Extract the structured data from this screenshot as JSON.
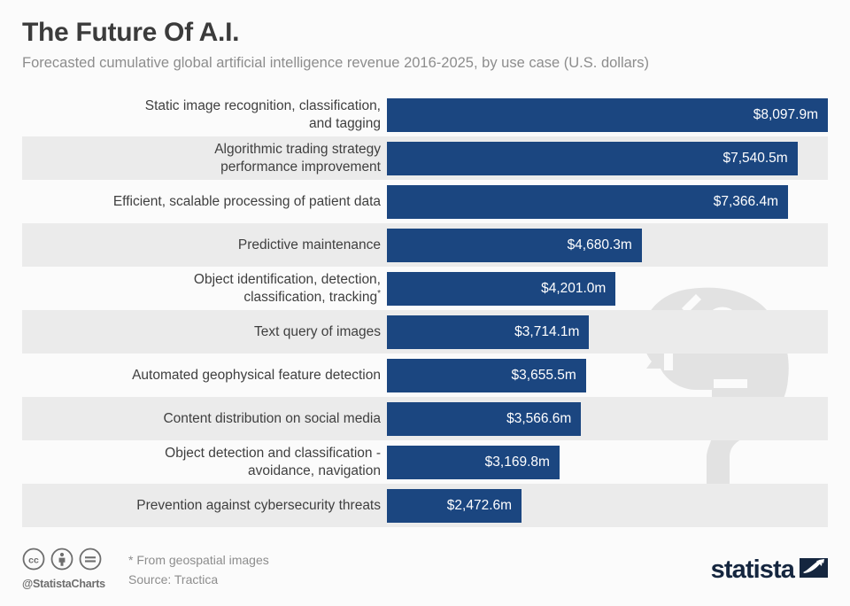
{
  "header": {
    "title": "The Future Of A.I.",
    "subtitle": "Forecasted cumulative global artificial intelligence revenue 2016-2025, by use case (U.S. dollars)"
  },
  "footer": {
    "cc_label": "cc",
    "handle": "@StatistaCharts",
    "footnote": "* From geospatial images",
    "source": "Source: Tractica",
    "logo_text": "statista",
    "icons": {
      "cc": "creative-commons-icon",
      "by": "attribution-person-icon",
      "nd": "no-derivatives-equals-icon",
      "logo_mark": "statista-swoosh-icon"
    }
  },
  "colors": {
    "bar": "#1b4680",
    "band": "#ebebeb",
    "background": "#fbfbfb",
    "title": "#3b3b3b",
    "subtitle": "#8d8d8d",
    "label": "#3f3f3f",
    "logo": "#15263f"
  },
  "chart_data": {
    "type": "bar",
    "orientation": "horizontal",
    "title": "The Future Of A.I.",
    "subtitle": "Forecasted cumulative global artificial intelligence revenue 2016-2025, by use case (U.S. dollars)",
    "xlabel": "",
    "ylabel": "",
    "unit": "millions of U.S. dollars",
    "grid": false,
    "legend": "none",
    "xlim": [
      0,
      8097.9
    ],
    "footnote": "* From geospatial images",
    "source": "Tractica",
    "categories": [
      "Static image recognition, classification, and tagging",
      "Algorithmic trading strategy performance improvement",
      "Efficient, scalable processing of patient data",
      "Predictive maintenance",
      "Object identification, detection, classification, tracking*",
      "Text query of images",
      "Automated geophysical feature detection",
      "Content distribution on social media",
      "Object detection and classification - avoidance, navigation",
      "Prevention against cybersecurity threats"
    ],
    "values": [
      8097.9,
      7540.5,
      7366.4,
      4680.3,
      4201.0,
      3714.1,
      3655.5,
      3566.6,
      3169.8,
      2472.6
    ],
    "value_labels": [
      "$8,097.9m",
      "$7,540.5m",
      "$7,366.4m",
      "$4,680.3m",
      "$4,201.0m",
      "$3,714.1m",
      "$3,655.5m",
      "$3,566.6m",
      "$3,169.8m",
      "$2,472.6m"
    ]
  },
  "rows": [
    {
      "label_line1": "Static image recognition, classification,",
      "label_line2": "and tagging",
      "value_label": "$8,097.9m",
      "value": 8097.9
    },
    {
      "label_line1": "Algorithmic trading strategy",
      "label_line2": "performance improvement",
      "value_label": "$7,540.5m",
      "value": 7540.5
    },
    {
      "label_line1": "Efficient, scalable processing of patient data",
      "label_line2": "",
      "value_label": "$7,366.4m",
      "value": 7366.4
    },
    {
      "label_line1": "Predictive maintenance",
      "label_line2": "",
      "value_label": "$4,680.3m",
      "value": 4680.3
    },
    {
      "label_line1": "Object identification, detection,",
      "label_line2": "classification, tracking",
      "label_sup": "*",
      "value_label": "$4,201.0m",
      "value": 4201.0
    },
    {
      "label_line1": "Text query of images",
      "label_line2": "",
      "value_label": "$3,714.1m",
      "value": 3714.1
    },
    {
      "label_line1": "Automated geophysical feature detection",
      "label_line2": "",
      "value_label": "$3,655.5m",
      "value": 3655.5
    },
    {
      "label_line1": "Content distribution on social media",
      "label_line2": "",
      "value_label": "$3,566.6m",
      "value": 3566.6
    },
    {
      "label_line1": "Object detection and classification -",
      "label_line2": "avoidance, navigation",
      "value_label": "$3,169.8m",
      "value": 3169.8
    },
    {
      "label_line1": "Prevention against cybersecurity threats",
      "label_line2": "",
      "value_label": "$2,472.6m",
      "value": 2472.6
    }
  ]
}
